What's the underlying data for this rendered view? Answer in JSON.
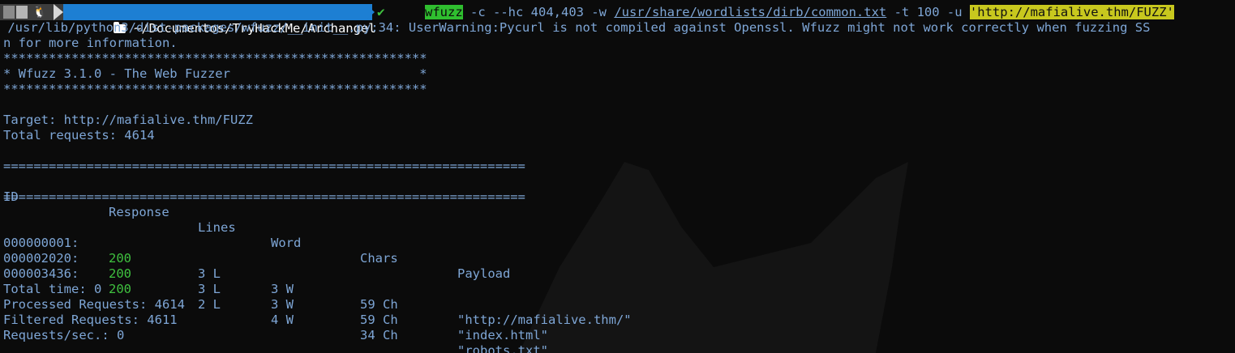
{
  "prompt": {
    "os_icon": "linux-tux-icon",
    "folder_icon": "folder-icon",
    "path": "~/Documentos/TryHackMe/Archangel",
    "status_icon": "check-icon",
    "status_glyph": "✔",
    "command": {
      "bin": "wfuzz",
      "args1": " -c --hc 404,403 -w ",
      "wordlist": "/usr/share/wordlists/dirb/common.txt",
      "args2": " -t 100 -u ",
      "url": "'http://mafialive.thm/FUZZ'"
    }
  },
  "warning_line1": " /usr/lib/python3/dist-packages/wfuzz/__init__.py:34: UserWarning:Pycurl is not compiled against Openssl. Wfuzz might not work correctly when fuzzing SS",
  "warning_line2": "n for more information.",
  "banner": {
    "stars": "********************************************************",
    "title": "* Wfuzz 3.1.0 - The Web Fuzzer                         *"
  },
  "target": "Target: http://mafialive.thm/FUZZ",
  "total_requests": "Total requests: 4614",
  "separator": "=====================================================================",
  "columns": [
    "ID",
    "Response",
    "Lines",
    "Word",
    "Chars",
    "Payload"
  ],
  "rows": [
    {
      "id": "000000001:",
      "response": "200",
      "lines": "3 L",
      "word": "3 W",
      "chars": "59 Ch",
      "payload": "\"http://mafialive.thm/\""
    },
    {
      "id": "000002020:",
      "response": "200",
      "lines": "3 L",
      "word": "3 W",
      "chars": "59 Ch",
      "payload": "\"index.html\""
    },
    {
      "id": "000003436:",
      "response": "200",
      "lines": "2 L",
      "word": "4 W",
      "chars": "34 Ch",
      "payload": "\"robots.txt\""
    }
  ],
  "summary": {
    "total_time": "Total time: 0",
    "processed": "Processed Requests: 4614",
    "filtered": "Filtered Requests: 4611",
    "rate": "Requests/sec.: 0"
  },
  "colors": {
    "background": "#0b0b0b",
    "text": "#7ea6d6",
    "status_ok": "#3fc13f",
    "path_segment": "#1d7fd3",
    "command_highlight": "#2fbe2f",
    "string_highlight": "#c8c81e"
  }
}
